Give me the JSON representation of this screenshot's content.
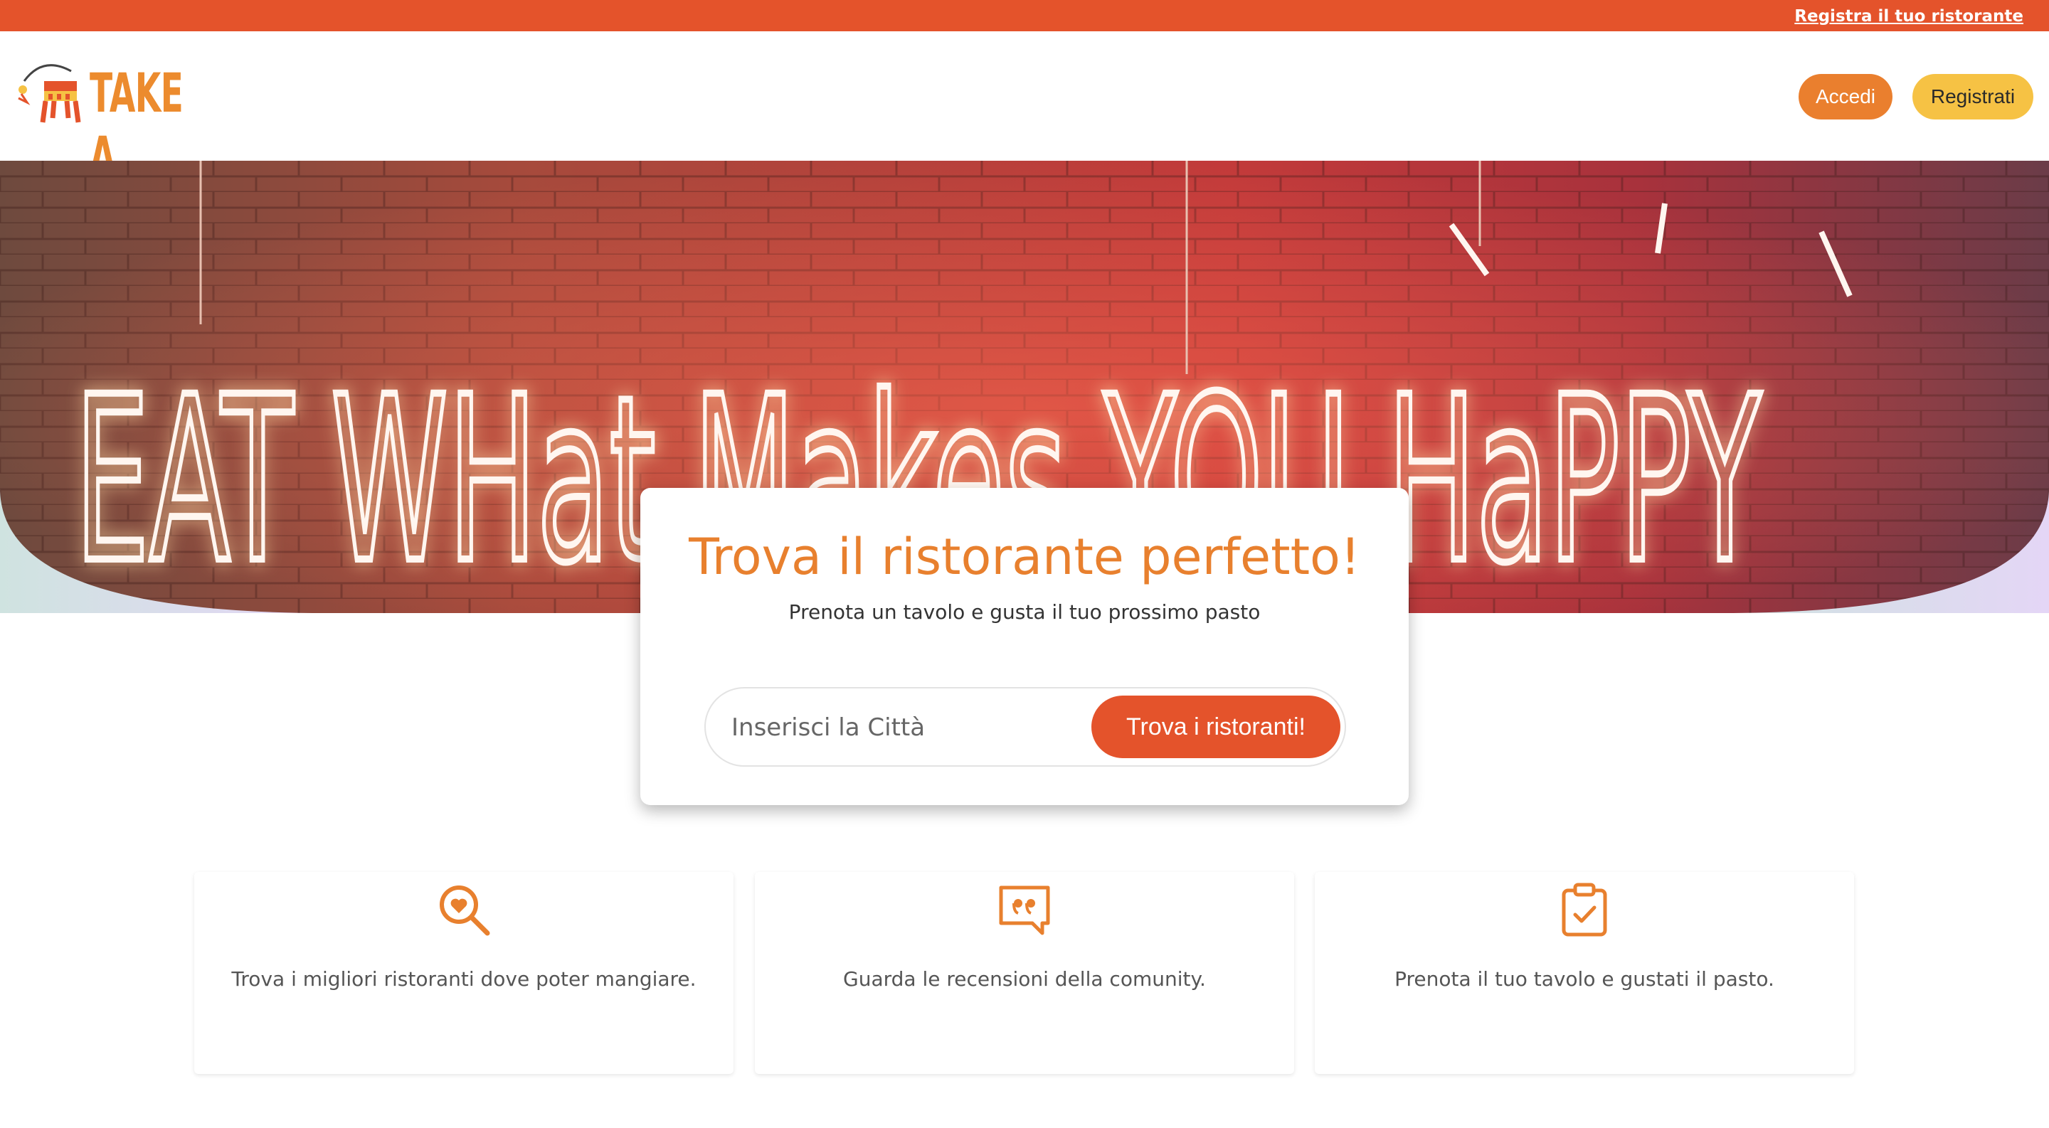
{
  "topbar": {
    "link": "Registra il tuo ristorante"
  },
  "header": {
    "logo_text": "TAKE A SIT",
    "login_label": "Accedi",
    "register_label": "Registrati"
  },
  "hero": {
    "neon_text": "EAT WHat Makes YOU HaPPY"
  },
  "search": {
    "title": "Trova il ristorante perfetto!",
    "subtitle": "Prenota un tavolo e gusta il tuo prossimo pasto",
    "placeholder": "Inserisci la Città",
    "button": "Trova i ristoranti!"
  },
  "features": [
    {
      "icon": "search-heart-icon",
      "text": "Trova i migliori ristoranti dove poter mangiare."
    },
    {
      "icon": "quote-bubble-icon",
      "text": "Guarda le recensioni della comunity."
    },
    {
      "icon": "clipboard-check-icon",
      "text": "Prenota il tuo tavolo e gustati il pasto."
    }
  ],
  "colors": {
    "brand_red": "#e4532b",
    "brand_orange": "#e8802e",
    "brand_yellow": "#f6c244"
  }
}
